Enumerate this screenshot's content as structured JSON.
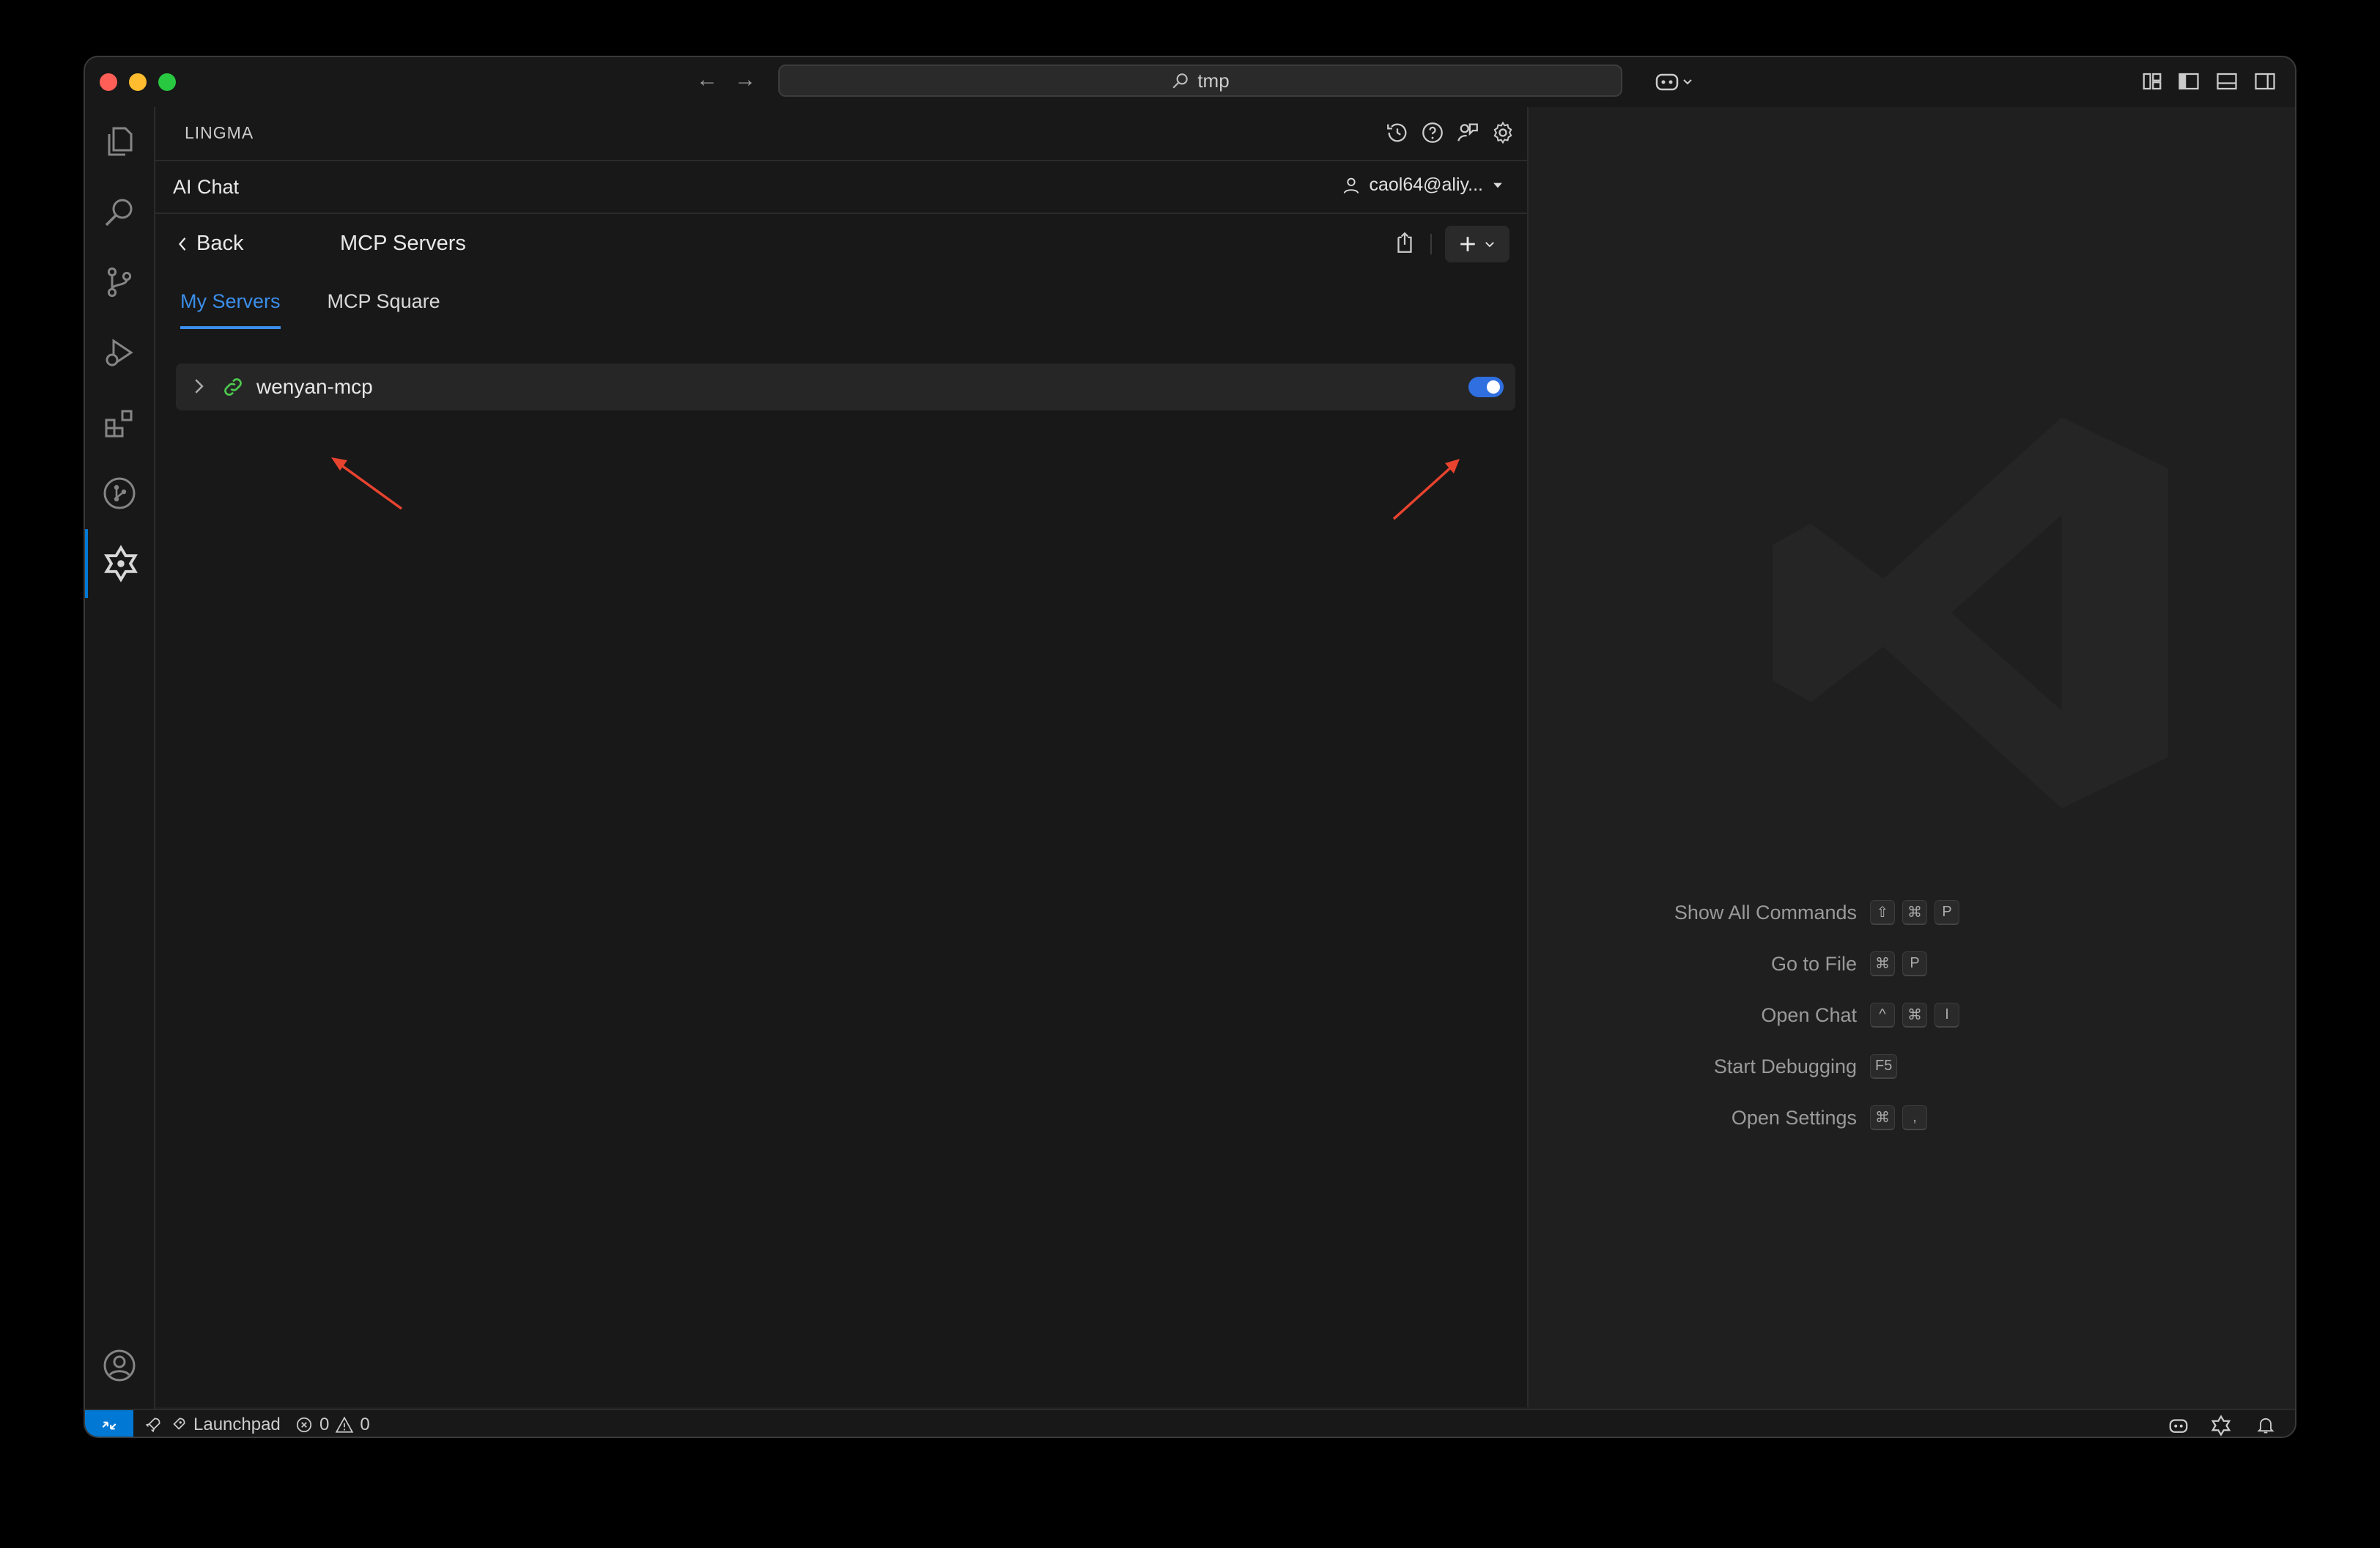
{
  "titlebar": {
    "search_text": "tmp"
  },
  "sidebar": {
    "title": "LINGMA",
    "chat_title": "AI Chat",
    "account": "caol64@aliy..."
  },
  "mcp": {
    "back_label": "Back",
    "title": "MCP Servers",
    "tabs": [
      {
        "label": "My Servers",
        "active": true
      },
      {
        "label": "MCP Square",
        "active": false
      }
    ],
    "servers": [
      {
        "name": "wenyan-mcp",
        "enabled": true
      }
    ]
  },
  "editor": {
    "shortcuts": [
      {
        "label": "Show All Commands",
        "keys": [
          "⇧",
          "⌘",
          "P"
        ]
      },
      {
        "label": "Go to File",
        "keys": [
          "⌘",
          "P"
        ]
      },
      {
        "label": "Open Chat",
        "keys": [
          "^",
          "⌘",
          "I"
        ]
      },
      {
        "label": "Start Debugging",
        "keys": [
          "F5"
        ]
      },
      {
        "label": "Open Settings",
        "keys": [
          "⌘",
          ","
        ]
      }
    ]
  },
  "statusbar": {
    "launchpad": "Launchpad",
    "errors": "0",
    "warnings": "0"
  },
  "colors": {
    "accent": "#0078d4",
    "tab_active": "#3b8eea",
    "toggle_on": "#2f6fe0",
    "link_icon": "#4ec94e",
    "annotation_arrow": "#e8432f"
  }
}
